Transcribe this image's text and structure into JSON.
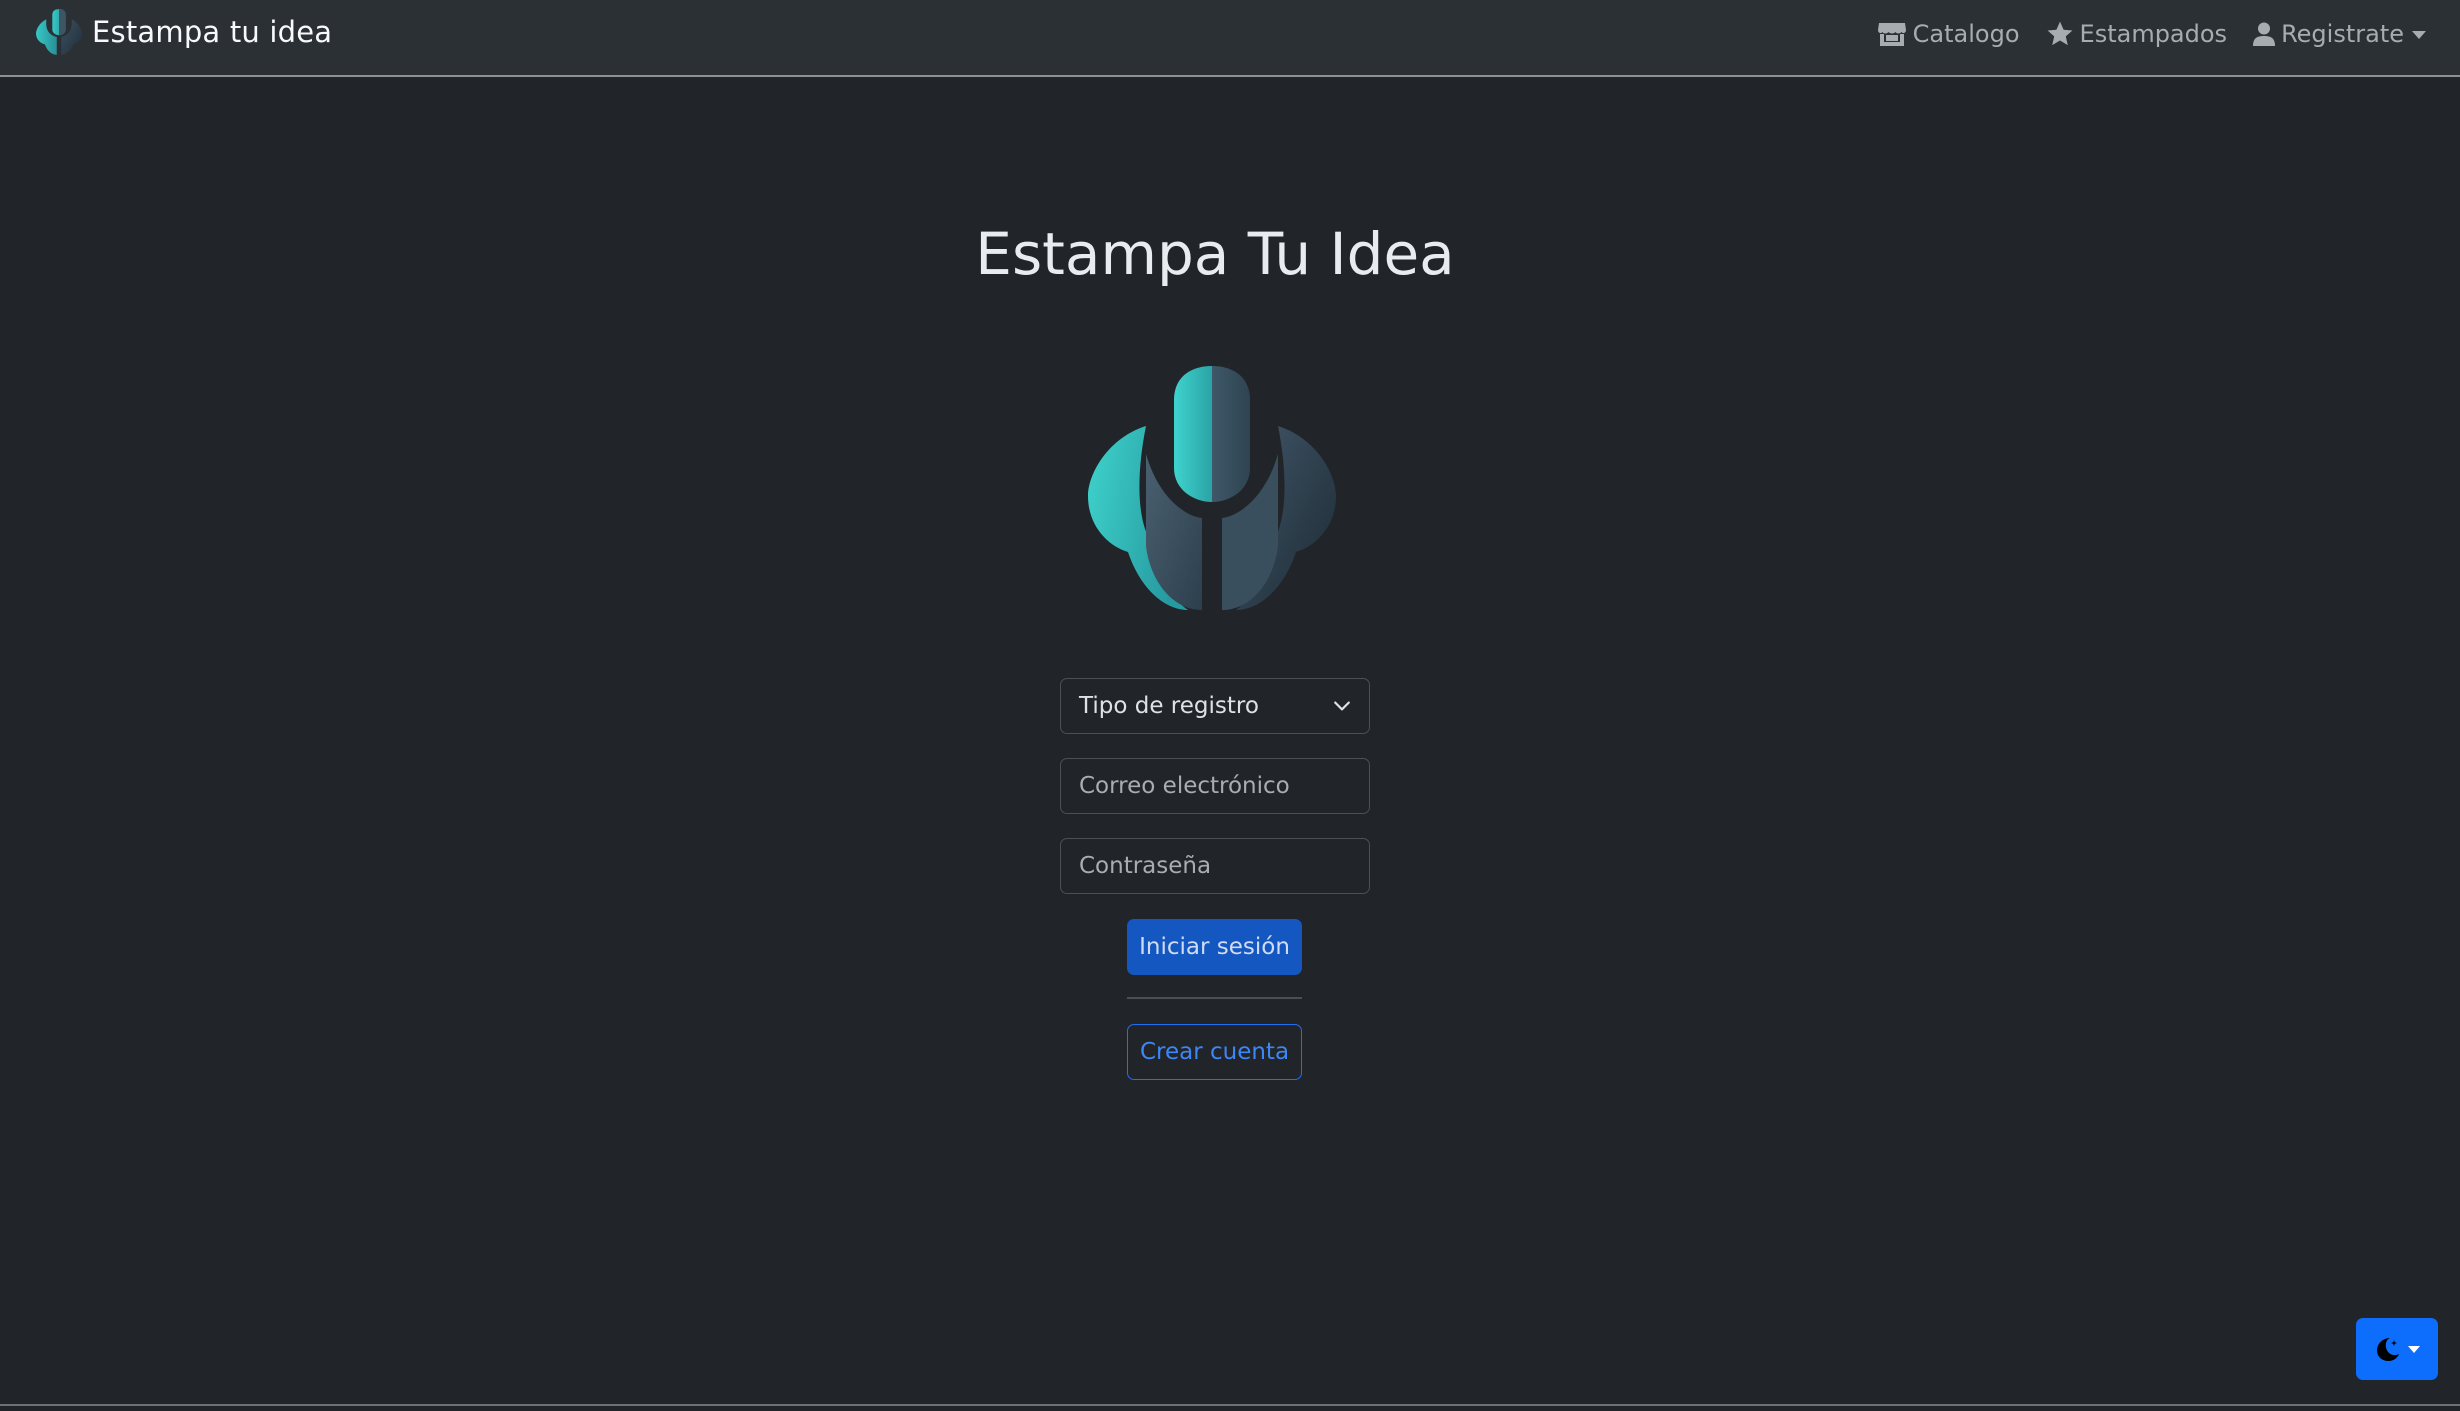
{
  "navbar": {
    "brand": "Estampa tu idea",
    "links": {
      "catalog": "Catalogo",
      "prints": "Estampados",
      "register": "Registrate"
    }
  },
  "main": {
    "title": "Estampa Tu Idea",
    "registration_type": {
      "selected": "Tipo de registro"
    },
    "email": {
      "placeholder": "Correo electrónico",
      "value": ""
    },
    "password": {
      "placeholder": "Contraseña",
      "value": ""
    },
    "login_button": "Iniciar sesión",
    "create_account_button": "Crear cuenta"
  },
  "icons": {
    "brand": "logo-icon",
    "catalog": "store-icon",
    "prints": "star-icon",
    "register": "user-icon",
    "theme": "moon-icon"
  },
  "colors": {
    "background": "#212529",
    "navbar": "#2b3035",
    "primary": "#0d6efd",
    "logo_teal": "#2ec4c4",
    "logo_slate": "#3b4b5c"
  }
}
